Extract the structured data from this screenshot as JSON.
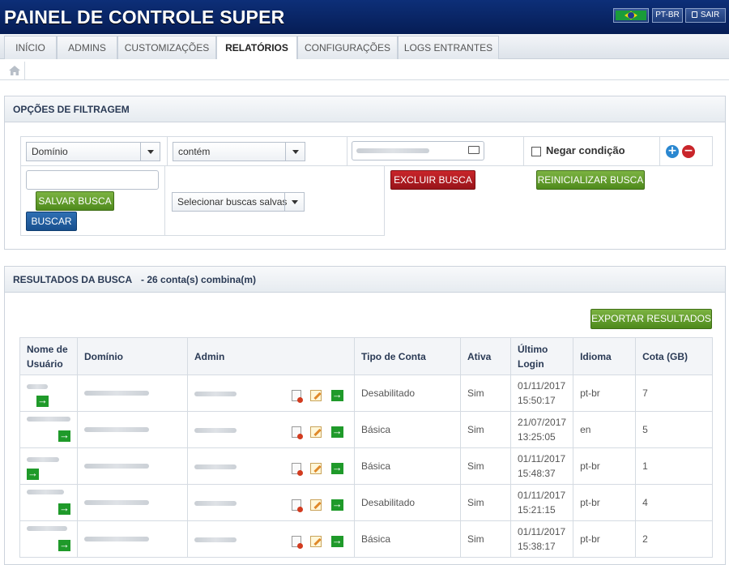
{
  "app_title": "PAINEL DE CONTROLE SUPER",
  "header": {
    "lang_label": "PT-BR",
    "logout_label": "SAIR"
  },
  "tabs": [
    {
      "label": "INÍCIO"
    },
    {
      "label": "ADMINS"
    },
    {
      "label": "CUSTOMIZAÇÕES"
    },
    {
      "label": "RELATÓRIOS"
    },
    {
      "label": "CONFIGURAÇÕES"
    },
    {
      "label": "LOGS ENTRANTES"
    }
  ],
  "filter": {
    "title": "OPÇÕES DE FILTRAGEM",
    "field_select": "Domínio",
    "operator_select": "contém",
    "negate_label": "Negar condição",
    "delete_search": "EXCLUIR BUSCA",
    "reset_search": "REINICIALIZAR BUSCA",
    "save_search": "SALVAR BUSCA",
    "search": "BUSCAR",
    "saved_searches": "Selecionar buscas salvas"
  },
  "results": {
    "title": "RESULTADOS DA BUSCA",
    "count_text": "- 26 conta(s) combina(m)",
    "export": "EXPORTAR RESULTADOS",
    "columns": {
      "user_l1": "Nome de",
      "user_l2": "Usuário",
      "domain": "Domínio",
      "admin": "Admin",
      "type": "Tipo de Conta",
      "active": "Ativa",
      "login_l1": "Último",
      "login_l2": "Login",
      "lang": "Idioma",
      "quota": "Cota (GB)"
    },
    "rows": [
      {
        "type": "Desabilitado",
        "active": "Sim",
        "date": "01/11/2017",
        "time": "15:50:17",
        "lang": "pt-br",
        "quota": "7"
      },
      {
        "type": "Básica",
        "active": "Sim",
        "date": "21/07/2017",
        "time": "13:25:05",
        "lang": "en",
        "quota": "5"
      },
      {
        "type": "Básica",
        "active": "Sim",
        "date": "01/11/2017",
        "time": "15:48:37",
        "lang": "pt-br",
        "quota": "1"
      },
      {
        "type": "Desabilitado",
        "active": "Sim",
        "date": "01/11/2017",
        "time": "15:21:15",
        "lang": "pt-br",
        "quota": "4"
      },
      {
        "type": "Básica",
        "active": "Sim",
        "date": "01/11/2017",
        "time": "15:38:17",
        "lang": "pt-br",
        "quota": "2"
      }
    ]
  }
}
